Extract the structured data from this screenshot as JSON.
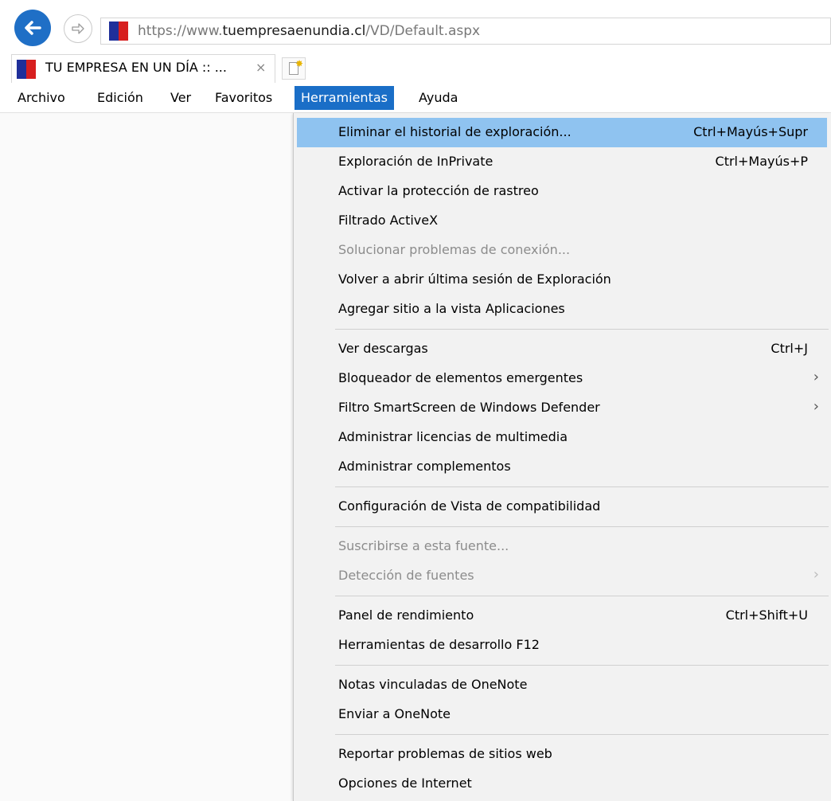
{
  "browser": {
    "url": {
      "scheme": "https://",
      "subdomain": "www.",
      "domain": "tuempresaenundia.cl",
      "path": "/VD/Default.aspx"
    },
    "tab": {
      "title": "TU EMPRESA EN UN DÍA :: ...",
      "close": "×"
    }
  },
  "menubar": {
    "items": [
      "Archivo",
      "Edición",
      "Ver",
      "Favoritos",
      "Herramientas",
      "Ayuda"
    ],
    "active": "Herramientas"
  },
  "dropdown": {
    "items": [
      {
        "label": "Eliminar el historial de exploración...",
        "shortcut": "Ctrl+Mayús+Supr",
        "highlighted": true
      },
      {
        "label": "Exploración de InPrivate",
        "shortcut": "Ctrl+Mayús+P"
      },
      {
        "label": "Activar la protección de rastreo"
      },
      {
        "label": "Filtrado ActiveX"
      },
      {
        "label": "Solucionar problemas de conexión...",
        "disabled": true
      },
      {
        "label": "Volver a abrir última sesión de Exploración"
      },
      {
        "label": "Agregar sitio a la vista Aplicaciones"
      },
      {
        "label": "Ver descargas",
        "shortcut": "Ctrl+J"
      },
      {
        "label": "Bloqueador de elementos emergentes",
        "submenu": "›"
      },
      {
        "label": "Filtro SmartScreen de Windows Defender",
        "submenu": "›"
      },
      {
        "label": "Administrar licencias de multimedia"
      },
      {
        "label": "Administrar complementos"
      },
      {
        "label": "Configuración de Vista de compatibilidad"
      },
      {
        "label": "Suscribirse a esta fuente...",
        "disabled": true
      },
      {
        "label": "Detección de fuentes",
        "submenu": "›",
        "disabled": true
      },
      {
        "label": "Panel de rendimiento",
        "shortcut": "Ctrl+Shift+U"
      },
      {
        "label": "Herramientas de desarrollo F12"
      },
      {
        "label": "Notas vinculadas de OneNote"
      },
      {
        "label": "Enviar a OneNote"
      },
      {
        "label": "Reportar problemas de sitios web"
      },
      {
        "label": "Opciones de Internet"
      }
    ]
  },
  "icons": {
    "back": "back-arrow-icon",
    "forward": "forward-arrow-icon",
    "site": "chile-flag-icon",
    "new_tab": "new-tab-icon"
  },
  "colors": {
    "back_button": "#1f6fc6",
    "menu_active": "#1a6ec7",
    "menu_highlight": "#8fc3f0",
    "flag_blue": "#1f2f9a",
    "flag_red": "#d71f1f"
  }
}
